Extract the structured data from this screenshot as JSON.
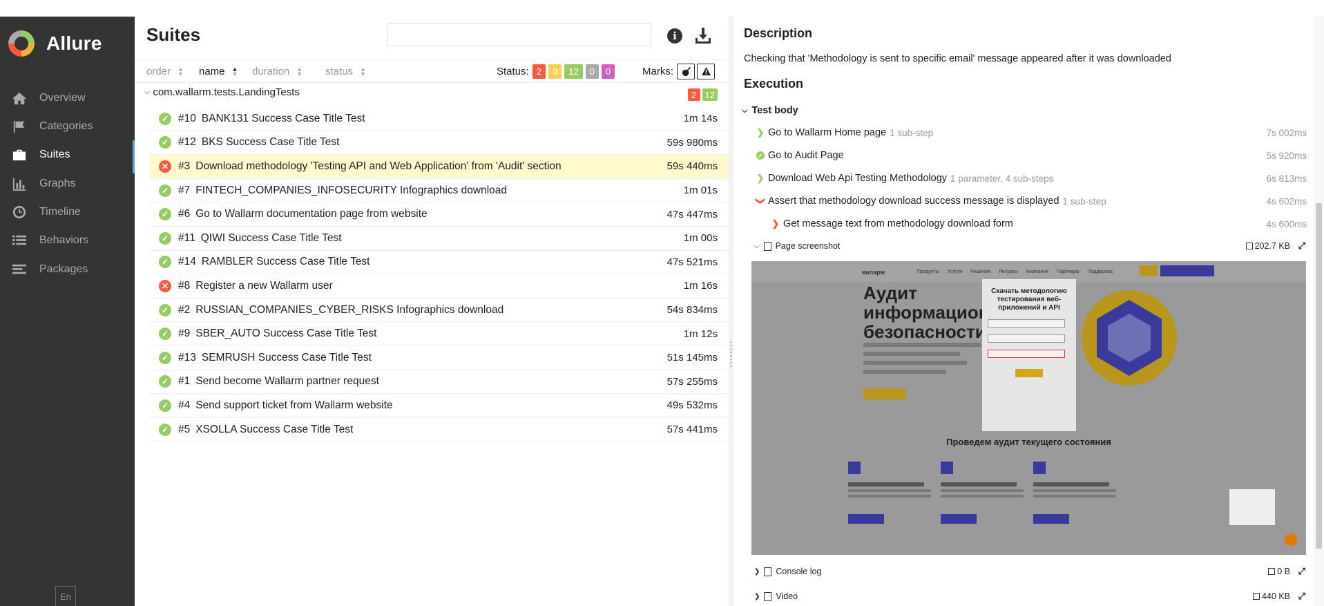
{
  "sidebar": {
    "brand": "Allure",
    "items": [
      {
        "label": "Overview",
        "icon": "home-icon"
      },
      {
        "label": "Categories",
        "icon": "flag-icon"
      },
      {
        "label": "Suites",
        "icon": "briefcase-icon",
        "active": true
      },
      {
        "label": "Graphs",
        "icon": "bar-chart-icon"
      },
      {
        "label": "Timeline",
        "icon": "clock-icon"
      },
      {
        "label": "Behaviors",
        "icon": "list-icon"
      },
      {
        "label": "Packages",
        "icon": "align-left-icon"
      }
    ],
    "language": "En"
  },
  "suites": {
    "title": "Suites",
    "search_value": "",
    "sort": {
      "order": "order",
      "name": "name",
      "duration": "duration",
      "status": "status"
    },
    "status_label": "Status:",
    "status_counts": {
      "failed": "2",
      "broken": "0",
      "passed": "12",
      "skipped": "0",
      "unknown": "0"
    },
    "marks_label": "Marks:",
    "group": {
      "name": "com.wallarm.tests.LandingTests",
      "failed": "2",
      "passed": "12"
    },
    "tests": [
      {
        "num": "#10",
        "name": "BANK131 Success Case Title Test",
        "duration": "1m 14s",
        "status": "passed"
      },
      {
        "num": "#12",
        "name": "BKS Success Case Title Test",
        "duration": "59s 980ms",
        "status": "passed"
      },
      {
        "num": "#3",
        "name": "Download methodology 'Testing API and Web Application' from 'Audit' section",
        "duration": "59s 440ms",
        "status": "failed",
        "selected": true
      },
      {
        "num": "#7",
        "name": "FINTECH_COMPANIES_INFOSECURITY Infographics download",
        "duration": "1m 01s",
        "status": "passed"
      },
      {
        "num": "#6",
        "name": "Go to Wallarm documentation page from website",
        "duration": "47s 447ms",
        "status": "passed"
      },
      {
        "num": "#11",
        "name": "QIWI Success Case Title Test",
        "duration": "1m 00s",
        "status": "passed"
      },
      {
        "num": "#14",
        "name": "RAMBLER Success Case Title Test",
        "duration": "47s 521ms",
        "status": "passed"
      },
      {
        "num": "#8",
        "name": "Register a new Wallarm user",
        "duration": "1m 16s",
        "status": "failed"
      },
      {
        "num": "#2",
        "name": "RUSSIAN_COMPANIES_CYBER_RISKS Infographics download",
        "duration": "54s 834ms",
        "status": "passed"
      },
      {
        "num": "#9",
        "name": "SBER_AUTO Success Case Title Test",
        "duration": "1m 12s",
        "status": "passed"
      },
      {
        "num": "#13",
        "name": "SEMRUSH Success Case Title Test",
        "duration": "51s 145ms",
        "status": "passed"
      },
      {
        "num": "#1",
        "name": "Send become Wallarm partner request",
        "duration": "57s 255ms",
        "status": "passed"
      },
      {
        "num": "#4",
        "name": "Send support ticket from Wallarm website",
        "duration": "49s 532ms",
        "status": "passed"
      },
      {
        "num": "#5",
        "name": "XSOLLA Success Case Title Test",
        "duration": "57s 441ms",
        "status": "passed"
      }
    ]
  },
  "details": {
    "description_heading": "Description",
    "description": "Checking that 'Methodology is sent to specific email' message appeared after it was downloaded",
    "execution_heading": "Execution",
    "test_body": "Test body",
    "steps": [
      {
        "name": "Go to Wallarm Home page",
        "meta": "1 sub-step",
        "duration": "7s 002ms",
        "state": "collapsed"
      },
      {
        "name": "Go to Audit Page",
        "meta": "",
        "duration": "5s 920ms",
        "state": "passed"
      },
      {
        "name": "Download Web Api Testing Methodology",
        "meta": "1 parameter, 4 sub-steps",
        "duration": "6s 813ms",
        "state": "collapsed"
      },
      {
        "name": "Assert that methodology download success message is displayed",
        "meta": "1 sub-step",
        "duration": "4s 602ms",
        "state": "expanded-failed"
      },
      {
        "name": "Get message text from methodology download form",
        "meta": "",
        "duration": "4s 600ms",
        "state": "failed-sub"
      }
    ],
    "attachments": [
      {
        "name": "Page screenshot",
        "size": "202.7 KB",
        "expanded": true
      },
      {
        "name": "Console log",
        "size": "0 B",
        "expanded": false
      },
      {
        "name": "Video",
        "size": "440 KB",
        "expanded": false
      }
    ],
    "screenshot": {
      "nav_logo": "валарм",
      "nav_links": "Продукты Услуги Решения Ресурсы Компания Партнеры Поддержка",
      "headline": "Аудит информационной безопасности",
      "modal_title": "Скачать методологию тестирования веб-приложений и API",
      "section_title": "Проведем аудит текущего состояния"
    }
  },
  "colors": {
    "sidebar_bg": "#343434",
    "passed": "#97cc64",
    "failed": "#fd5a3e",
    "broken": "#ffd050",
    "skipped": "#aaaaaa",
    "unknown": "#d35ebe",
    "selected_row": "#fffacd",
    "active_accent": "#5ca3d8"
  }
}
